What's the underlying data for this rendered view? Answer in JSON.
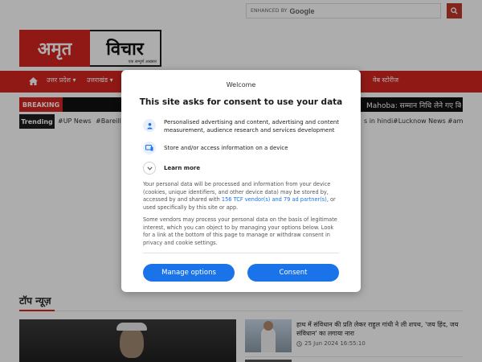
{
  "search": {
    "enhanced_label": "ENHANCED BY",
    "provider": "Google"
  },
  "logo": {
    "left_text": "अमृत",
    "right_text": "विचार",
    "tagline": "एक सम्पूर्ण अखबार"
  },
  "nav": {
    "items": [
      "उत्तर प्रदेश ▾",
      "उत्तराखंड ▾",
      "वेब स्टोरीज"
    ]
  },
  "breaking": {
    "label": "BREAKING",
    "text": "Mahoba: सम्मान निधि लेने गए किसान"
  },
  "trending": {
    "label": "Trending",
    "tags": [
      "#UP News",
      "#Bareilly",
      "s in hindi",
      "#Lucknow News",
      "#am"
    ]
  },
  "top_news": {
    "title": "टॉप न्यूज़",
    "item": {
      "headline": "हाथ में संविधान की प्रति लेकर राहुल गांधी ने ली शपथ, 'जय हिंद, जय संविधान' का लगाया नारा",
      "time": "25 Jun 2024 16:55:10"
    }
  },
  "consent": {
    "site": "Welcome",
    "title": "This site asks for consent to use your data",
    "purposes": [
      "Personalised advertising and content, advertising and content measurement, audience research and services development",
      "Store and/or access information on a device"
    ],
    "learn_more": "Learn more",
    "para1_before": "Your personal data will be processed and information from your device (cookies, unique identifiers, and other device data) may be stored by, accessed by and shared with ",
    "para1_link": "156 TCF vendor(s) and 79 ad partner(s)",
    "para1_after": ", or used specifically by this site or app.",
    "para2": "Some vendors may process your personal data on the basis of legitimate interest, which you can object to by managing your options below. Look for a link at the bottom of this page to manage or withdraw consent in privacy and cookie settings.",
    "manage_label": "Manage options",
    "consent_label": "Consent"
  },
  "colors": {
    "brand_red": "#d6251f",
    "button_blue": "#1a73e8"
  }
}
